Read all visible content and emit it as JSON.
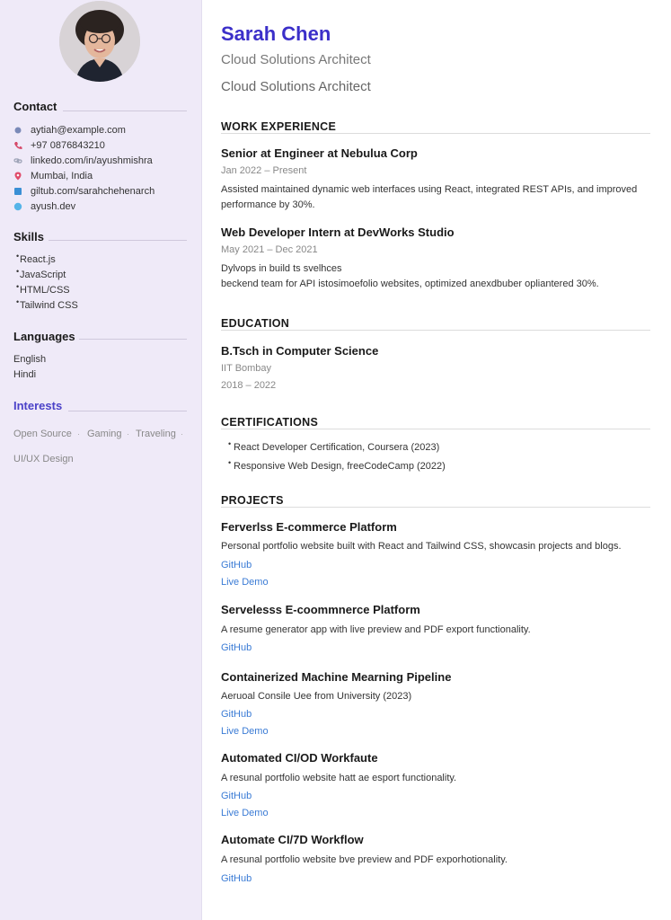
{
  "sidebar": {
    "contact_heading": "Contact",
    "contact": [
      {
        "icon": "email-icon",
        "text": "aytiah@example.com",
        "color": "#7a8ab8"
      },
      {
        "icon": "phone-icon",
        "text": "+97 0876843210",
        "color": "#d64a6a"
      },
      {
        "icon": "link-icon",
        "text": "linkedo.com/in/ayushmishra",
        "color": "#9aa0b4"
      },
      {
        "icon": "location-pin-icon",
        "text": "Mumbai, India",
        "color": "#e04b6a"
      },
      {
        "icon": "github-icon",
        "text": "giltub.com/sarahchehenarch",
        "color": "#3a8fd5"
      },
      {
        "icon": "globe-icon",
        "text": "ayush.dev",
        "color": "#56b4e8"
      }
    ],
    "skills_heading": "Skills",
    "skills": [
      "React.js",
      "JavaScript",
      "HTML/CSS",
      "Tailwind CSS"
    ],
    "languages_heading": "Languages",
    "languages": [
      "English",
      "Hindi"
    ],
    "interests_heading": "Interests",
    "interests": [
      "Open Source",
      "Gaming",
      "Traveling",
      "UI/UX Design"
    ]
  },
  "header": {
    "name": "Sarah Chen",
    "subtitle1": "Cloud Solutions Architect",
    "subtitle2": "Cloud Solutions Architect"
  },
  "work": {
    "heading": "WORK EXPERIENCE",
    "items": [
      {
        "title": "Senior at Engineer at Nebulua Corp",
        "dates": "Jan 2022 – Present",
        "desc": "Assisted maintained dynamic web interfaces using React, integrated REST APIs, and improved performance by 30%."
      },
      {
        "title": "Web Developer Intern at DevWorks Studio",
        "dates": "May 2021 – Dec 2021",
        "desc_line1": "Dylvops in build ts svelhces",
        "desc_line2": "beckend team for API istosimoefolio websites, optimized anexdbuber opliantered 30%."
      }
    ]
  },
  "education": {
    "heading": "EDUCATION",
    "degree": "B.Tsch in Computer Science",
    "school": "IIT Bombay",
    "years": "2018 – 2022"
  },
  "certifications": {
    "heading": "CERTIFICATIONS",
    "items": [
      "React Developer Certification, Coursera (2023)",
      "Responsive Web Design, freeCodeCamp (2022)"
    ]
  },
  "projects": {
    "heading": "PROJECTS",
    "items": [
      {
        "title": "Ferverlss E-commerce Platform",
        "desc": "Personal portfolio website built with React and Tailwind CSS, showcasin projects and blogs.",
        "links": [
          "GitHub",
          "Live Demo"
        ]
      },
      {
        "title": "Servelesss E-coommnerce Platform",
        "desc": "A resume generator app with live preview and PDF export functionality.",
        "links": [
          "GitHub"
        ]
      },
      {
        "title": "Containerized Machine Mearning Pipeline",
        "desc": "Aeruoal Consile Uee from University (2023)",
        "links": [
          "GitHub",
          "Live Demo"
        ]
      },
      {
        "title": "Automated CI/OD Workfaute",
        "desc": "A resunal portfolio website hatt ae esport functionality.",
        "links": [
          "GitHub",
          "Live Demo"
        ]
      },
      {
        "title": "Automate CI/7D Workflow",
        "desc": "A resunal portfolio website bve preview and PDF exporhotionality.",
        "links": [
          "GitHub"
        ]
      }
    ]
  }
}
